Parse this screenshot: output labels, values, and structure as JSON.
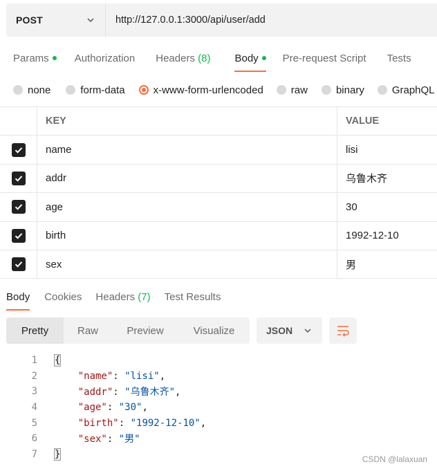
{
  "request": {
    "method": "POST",
    "url": "http://127.0.0.1:3000/api/user/add"
  },
  "request_tabs": [
    {
      "label": "Params",
      "dot": true,
      "count": ""
    },
    {
      "label": "Authorization",
      "dot": false,
      "count": ""
    },
    {
      "label": "Headers",
      "dot": false,
      "count": "(8)"
    },
    {
      "label": "Body",
      "dot": true,
      "count": "",
      "active": true
    },
    {
      "label": "Pre-request Script",
      "dot": false,
      "count": ""
    },
    {
      "label": "Tests",
      "dot": false,
      "count": ""
    }
  ],
  "body_types": [
    {
      "label": "none",
      "selected": false
    },
    {
      "label": "form-data",
      "selected": false
    },
    {
      "label": "x-www-form-urlencoded",
      "selected": true
    },
    {
      "label": "raw",
      "selected": false
    },
    {
      "label": "binary",
      "selected": false
    },
    {
      "label": "GraphQL",
      "selected": false
    }
  ],
  "params_table": {
    "headers": {
      "key": "KEY",
      "value": "VALUE"
    },
    "rows": [
      {
        "key": "name",
        "value": "lisi",
        "checked": true
      },
      {
        "key": "addr",
        "value": "乌鲁木齐",
        "checked": true
      },
      {
        "key": "age",
        "value": "30",
        "checked": true
      },
      {
        "key": "birth",
        "value": "1992-12-10",
        "checked": true
      },
      {
        "key": "sex",
        "value": "男",
        "checked": true
      }
    ]
  },
  "response_tabs": [
    {
      "label": "Body",
      "count": "",
      "active": true
    },
    {
      "label": "Cookies",
      "count": ""
    },
    {
      "label": "Headers",
      "count": "(7)"
    },
    {
      "label": "Test Results",
      "count": ""
    }
  ],
  "response_view": {
    "modes": [
      "Pretty",
      "Raw",
      "Preview",
      "Visualize"
    ],
    "active_mode": "Pretty",
    "language": "JSON"
  },
  "response_body": {
    "line_numbers": [
      "1",
      "2",
      "3",
      "4",
      "5",
      "6",
      "7"
    ],
    "open_brace": "{",
    "close_brace": "}",
    "fields": [
      {
        "key": "\"name\"",
        "value": "\"lisi\"",
        "comma": ","
      },
      {
        "key": "\"addr\"",
        "value": "\"乌鲁木齐\"",
        "comma": ","
      },
      {
        "key": "\"age\"",
        "value": "\"30\"",
        "comma": ","
      },
      {
        "key": "\"birth\"",
        "value": "\"1992-12-10\"",
        "comma": ","
      },
      {
        "key": "\"sex\"",
        "value": "\"男\"",
        "comma": ""
      }
    ]
  },
  "watermark": "CSDN @lalaxuan",
  "colors": {
    "accent": "#ff6c37",
    "success": "#0cbb52",
    "json_key": "#a31515",
    "json_string": "#0451a5"
  },
  "icons": {
    "method_dropdown": "chevron-down-icon",
    "language_dropdown": "chevron-down-icon",
    "wrap": "wrap-lines-icon",
    "checkbox": "check-icon"
  }
}
